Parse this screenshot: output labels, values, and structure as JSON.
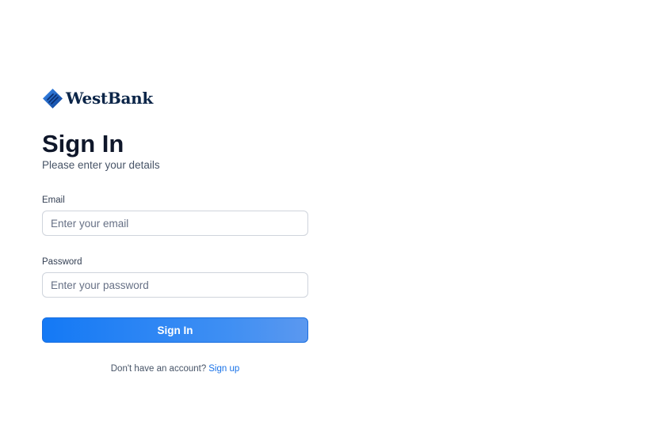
{
  "brand": {
    "name": "WestBank",
    "logo_icon": "diamond-logo-icon",
    "primary_color": "#0b2548"
  },
  "heading": {
    "title": "Sign In",
    "subtitle": "Please enter your details"
  },
  "form": {
    "email": {
      "label": "Email",
      "value": "",
      "placeholder": "Enter your email"
    },
    "password": {
      "label": "Password",
      "value": "",
      "placeholder": "Enter your password"
    },
    "submit_label": "Sign In",
    "accent_color": "#1479f5"
  },
  "footer": {
    "prompt": "Don't have an account?",
    "link_label": "Sign up",
    "link_color": "#1a73e8"
  }
}
